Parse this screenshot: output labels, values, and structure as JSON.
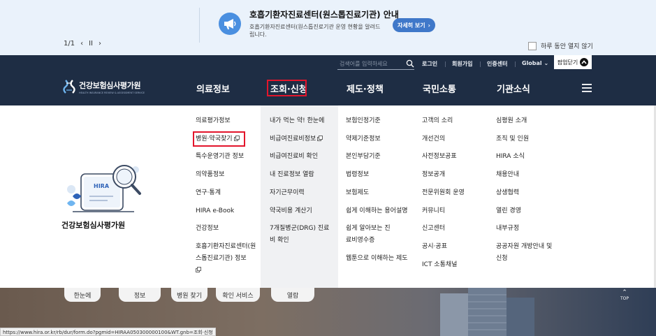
{
  "popup": {
    "pager": {
      "current": "1/1",
      "prev": "‹",
      "pause": "II",
      "next": "›"
    },
    "title": "호흡기환자진료센터(원스톱진료기관) 안내",
    "description": "호흡기환자진료센터(원스톱진료기관 운영 현황을 알려드립니다.",
    "detail_button": "자세히 보기",
    "no_show_today": "하루 동안 열지 않기",
    "close": "팝업닫기",
    "icon": "megaphone-icon",
    "accent_color": "#3f78c9"
  },
  "header": {
    "background": "#1e2d44",
    "search": {
      "placeholder": "검색어를 입력하세요"
    },
    "utility": {
      "login": "로그인",
      "signup": "회원가입",
      "cert": "인증센터",
      "global": "Global"
    },
    "logo": {
      "text": "건강보험심사평가원",
      "sub": "HEALTH INSURANCE REVIEW & ASSESSMENT SERVICE"
    },
    "gnb": [
      {
        "label": "의료정보"
      },
      {
        "label": "조회·신청"
      },
      {
        "label": "제도·정책"
      },
      {
        "label": "국민소통"
      },
      {
        "label": "기관소식"
      }
    ],
    "highlight_color": "#e3152b"
  },
  "mega_menu": {
    "illustration_label": "HIRA",
    "org_name": "건강보험심사평가원",
    "columns": [
      [
        "의료평가정보",
        "병원·약국찾기",
        "특수운영기관 정보",
        "의약품정보",
        "연구·통계",
        "HIRA e-Book",
        "건강정보",
        "호흡기환자진료센터(원스톱진료기관) 정보"
      ],
      [
        "내가 먹는 약! 한눈에",
        "비급여진료비정보",
        "비급여진료비 확인",
        "내 진료정보 열람",
        "자기근무이력",
        "약국비용 계산기",
        "7개질병군(DRG) 진료비 확인"
      ],
      [
        "보험인정기준",
        "약제기준정보",
        "본인부담기준",
        "법령정보",
        "보험제도",
        "쉽게 이해하는 용어설명",
        "쉽게 알아보는 진료비영수증",
        "웹툰으로 이해하는 제도"
      ],
      [
        "고객의 소리",
        "개선건의",
        "사전정보공표",
        "정보공개",
        "전문위원회 운영",
        "커뮤니티",
        "신고센터",
        "공시·공표",
        "ICT 소통채널"
      ],
      [
        "심평원 소개",
        "조직 및 인원",
        "HIRA 소식",
        "채용안내",
        "상생협력",
        "열린 경영",
        "내부규정",
        "공공자원 개방안내 및 신청"
      ]
    ]
  },
  "background": {
    "quick_buttons": [
      "한눈에",
      "정보",
      "병원 찾기",
      "확인 서비스",
      "열람"
    ],
    "top_button": "TOP"
  },
  "status_bar": {
    "url": "https://www.hira.or.kr/rb/dur/form.do?pgmid=HIRAA050300000100&WT.gnb=조회·신청"
  }
}
